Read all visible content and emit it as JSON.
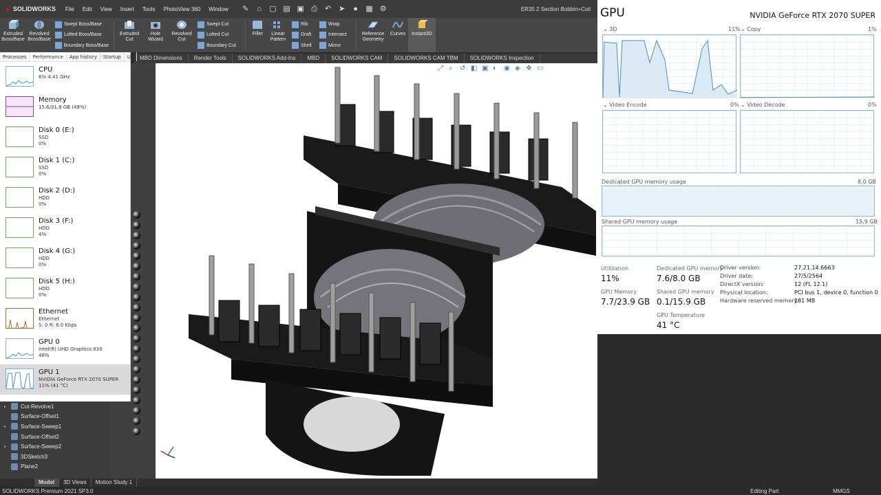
{
  "solidworks": {
    "brand": "SOLIDWORKS",
    "menu": [
      "File",
      "Edit",
      "View",
      "Insert",
      "Tools",
      "PhotoView 360",
      "Window"
    ],
    "doc_title": "ER35 2 Section Bobbin+Coil",
    "ribbon": {
      "extruded_boss": "Extruded Boss/Base",
      "revolved_boss": "Revolved Boss/Base",
      "swept_boss": "Swept Boss/Base",
      "lofted_boss": "Lofted Boss/Base",
      "boundary_boss": "Boundary Boss/Base",
      "extruded_cut": "Extruded Cut",
      "hole_wizard": "Hole Wizard",
      "revolved_cut": "Revolved Cut",
      "swept_cut": "Swept Cut",
      "lofted_cut": "Lofted Cut",
      "boundary_cut": "Boundary Cut",
      "fillet": "Fillet",
      "linear_pattern": "Linear Pattern",
      "rib": "Rib",
      "draft": "Draft",
      "shell": "Shell",
      "wrap": "Wrap",
      "intersect": "Intersect",
      "mirror": "Mirror",
      "reference_geometry": "Reference Geometry",
      "curves": "Curves",
      "instant3d": "Instant3D"
    },
    "cm_tabs": [
      "MBD Dimensions",
      "Render Tools",
      "SOLIDWORKS Add-Ins",
      "MBD",
      "SOLIDWORKS CAM",
      "SOLIDWORKS CAM TBM",
      "SOLIDWORKS Inspection"
    ],
    "tree": [
      {
        "label": "Cut-Revolve1",
        "exp": "▸"
      },
      {
        "label": "Surface-Offset1",
        "exp": ""
      },
      {
        "label": "Surface-Sweep1",
        "exp": "▸"
      },
      {
        "label": "Surface-Offset2",
        "exp": ""
      },
      {
        "label": "Surface-Sweep2",
        "exp": "▸"
      },
      {
        "label": "3DSketch3",
        "exp": ""
      },
      {
        "label": "Plane2",
        "exp": ""
      }
    ],
    "bottom_tabs": [
      "Model",
      "3D Views",
      "Motion Study 1"
    ],
    "status_left": "SOLIDWORKS Premium 2021 SP3.0",
    "status_mid": "Editing Part",
    "status_units": "MMGS"
  },
  "taskmgr": {
    "tabs": [
      "Processes",
      "Performance",
      "App history",
      "Startup",
      "Us"
    ],
    "items": [
      {
        "name": "CPU",
        "sub1": "6% 4.41 GHz",
        "sub2": "",
        "sub3": "",
        "kind": "cpu"
      },
      {
        "name": "Memory",
        "sub1": "15.6/31.8 GB (49%)",
        "sub2": "",
        "sub3": "",
        "kind": "mem"
      },
      {
        "name": "Disk 0 (E:)",
        "sub1": "SSD",
        "sub2": "0%",
        "sub3": "",
        "kind": "disk"
      },
      {
        "name": "Disk 1 (C:)",
        "sub1": "SSD",
        "sub2": "0%",
        "sub3": "",
        "kind": "disk"
      },
      {
        "name": "Disk 2 (D:)",
        "sub1": "HDD",
        "sub2": "0%",
        "sub3": "",
        "kind": "disk"
      },
      {
        "name": "Disk 3 (F:)",
        "sub1": "HDD",
        "sub2": "4%",
        "sub3": "",
        "kind": "disk"
      },
      {
        "name": "Disk 4 (G:)",
        "sub1": "HDD",
        "sub2": "0%",
        "sub3": "",
        "kind": "disk"
      },
      {
        "name": "Disk 5 (H:)",
        "sub1": "HDD",
        "sub2": "0%",
        "sub3": "",
        "kind": "disk"
      },
      {
        "name": "Ethernet",
        "sub1": "Ethernet",
        "sub2": "S: 0 R: 8.0 Kbps",
        "sub3": "",
        "kind": "net"
      },
      {
        "name": "GPU 0",
        "sub1": "Intel(R) UHD Graphics 630",
        "sub2": "46%",
        "sub3": "",
        "kind": "cpu"
      },
      {
        "name": "GPU 1",
        "sub1": "NVIDIA GeForce RTX 2070 SUPER",
        "sub2": "11% (41 °C)",
        "sub3": "",
        "kind": "cpu"
      }
    ]
  },
  "gpu": {
    "title": "GPU",
    "name": "NVIDIA GeForce RTX 2070 SUPER",
    "graphs": {
      "g3d": {
        "label": "3D",
        "pct": "11%"
      },
      "copy": {
        "label": "Copy",
        "pct": "1%"
      },
      "venc": {
        "label": "Video Encode",
        "pct": "0%"
      },
      "vdec": {
        "label": "Video Decode",
        "pct": "0%"
      }
    },
    "dedicated_label": "Dedicated GPU memory usage",
    "dedicated_max": "8.0 GB",
    "shared_label": "Shared GPU memory usage",
    "shared_max": "15.9 GB",
    "stats": {
      "util_label": "Utilization",
      "util_value": "11%",
      "ded_label": "Dedicated GPU memory",
      "ded_value": "7.6/8.0 GB",
      "gmem_label": "GPU Memory",
      "gmem_value": "7.7/23.9 GB",
      "shared_label": "Shared GPU memory",
      "shared_value": "0.1/15.9 GB",
      "temp_label": "GPU Temperature",
      "temp_value": "41 °C"
    },
    "details": [
      {
        "k": "Driver version:",
        "v": "27.21.14.6663"
      },
      {
        "k": "Driver date:",
        "v": "27/5/2564"
      },
      {
        "k": "DirectX version:",
        "v": "12 (FL 12.1)"
      },
      {
        "k": "Physical location:",
        "v": "PCI bus 1, device 0, function 0"
      },
      {
        "k": "Hardware reserved memory:",
        "v": "181 MB"
      }
    ]
  },
  "colors": {
    "accent": "#1e70c0",
    "graph_line": "#4a8ec8",
    "mem": "#9a3e9a",
    "disk": "#6aa84f",
    "net": "#b5651d"
  }
}
